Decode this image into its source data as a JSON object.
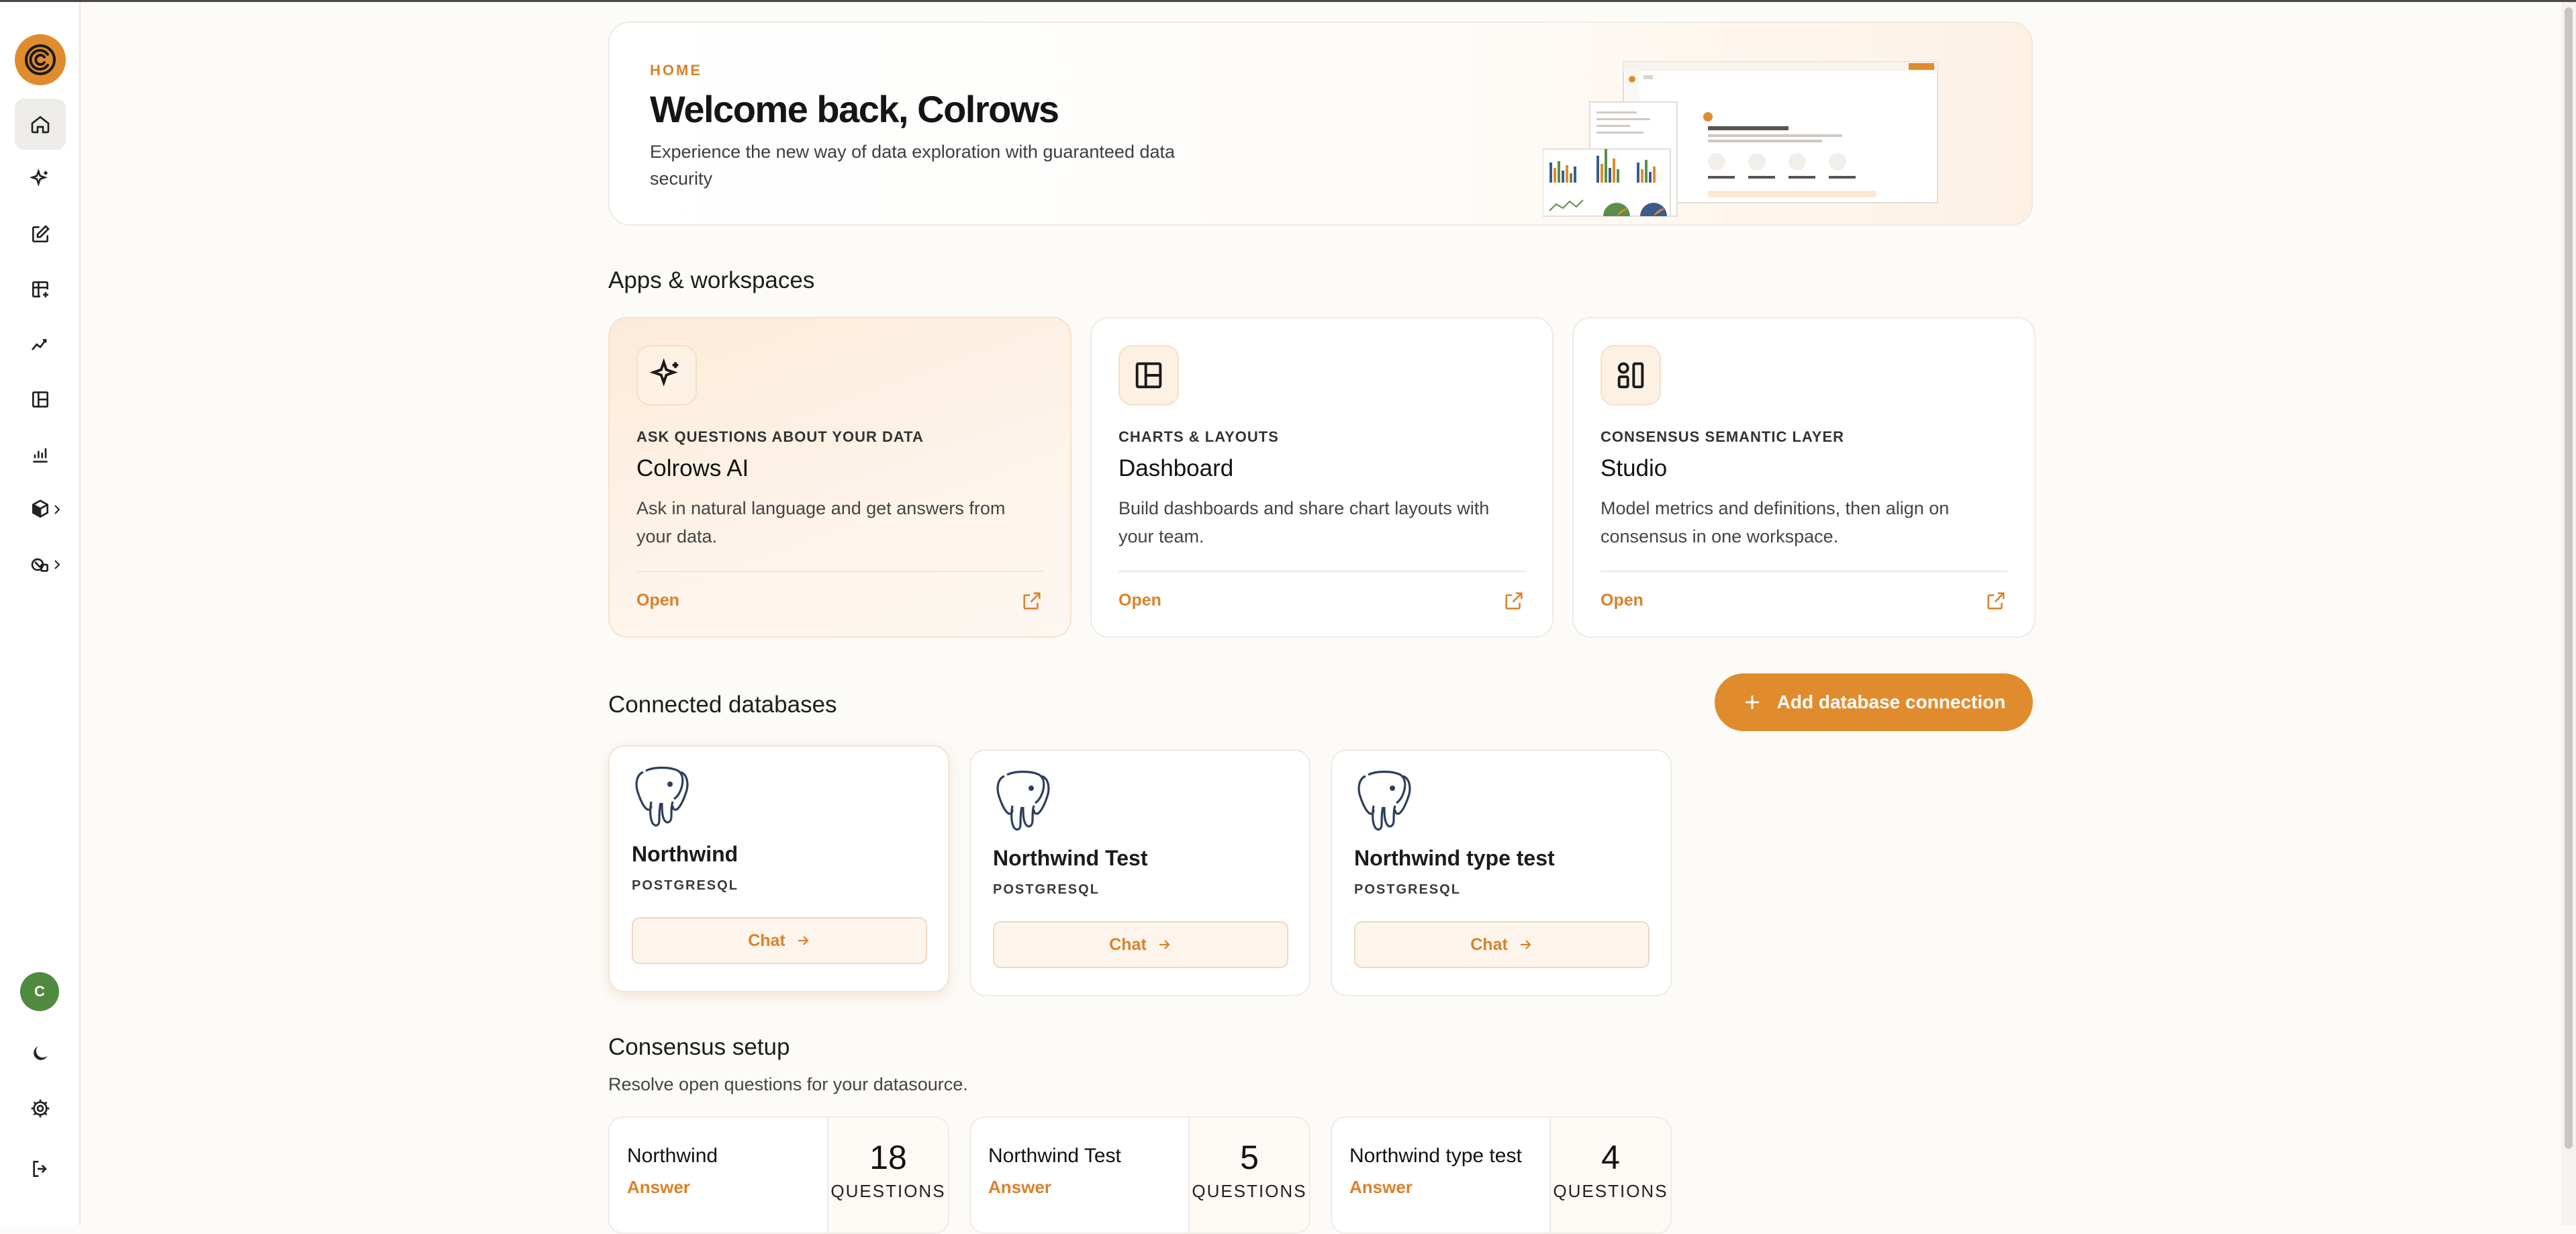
{
  "colors": {
    "accent": "#e08c2e",
    "accent_text": "#d9822b",
    "avatar_bg": "#4f8a3f"
  },
  "sidebar": {
    "logo_icon": "colrows-logo-icon",
    "items": [
      {
        "icon": "home-icon"
      },
      {
        "icon": "sparkle-icon"
      },
      {
        "icon": "edit-icon"
      },
      {
        "icon": "table-add-icon"
      },
      {
        "icon": "trend-line-icon"
      },
      {
        "icon": "layout-icon"
      },
      {
        "icon": "bar-chart-icon"
      },
      {
        "icon": "cube-icon"
      },
      {
        "icon": "data-group-icon"
      }
    ],
    "avatar_initial": "C",
    "bottom": [
      {
        "icon": "moon-icon"
      },
      {
        "icon": "gear-icon"
      },
      {
        "icon": "logout-icon"
      }
    ]
  },
  "hero": {
    "kicker": "HOME",
    "title": "Welcome back, Colrows",
    "subtitle": "Experience the new way of data exploration with guaranteed data security"
  },
  "apps": {
    "title": "Apps & workspaces",
    "cards": [
      {
        "icon": "sparkle-icon",
        "kicker": "ASK QUESTIONS ABOUT YOUR DATA",
        "name": "Colrows AI",
        "desc": "Ask in natural language and get answers from your data.",
        "open": "Open"
      },
      {
        "icon": "layout-icon",
        "kicker": "CHARTS & LAYOUTS",
        "name": "Dashboard",
        "desc": "Build dashboards and share chart layouts with your team.",
        "open": "Open"
      },
      {
        "icon": "studio-icon",
        "kicker": "CONSENSUS SEMANTIC LAYER",
        "name": "Studio",
        "desc": "Model metrics and definitions, then align on consensus in one workspace.",
        "open": "Open"
      }
    ]
  },
  "databases": {
    "title": "Connected databases",
    "add_label": "Add database connection",
    "items": [
      {
        "name": "Northwind",
        "type": "POSTGRESQL",
        "chat": "Chat"
      },
      {
        "name": "Northwind Test",
        "type": "POSTGRESQL",
        "chat": "Chat"
      },
      {
        "name": "Northwind type test",
        "type": "POSTGRESQL",
        "chat": "Chat"
      }
    ]
  },
  "consensus": {
    "title": "Consensus setup",
    "subtitle": "Resolve open questions for your datasource.",
    "items": [
      {
        "name": "Northwind",
        "action": "Answer",
        "count": "18",
        "label": "QUESTIONS"
      },
      {
        "name": "Northwind Test",
        "action": "Answer",
        "count": "5",
        "label": "QUESTIONS"
      },
      {
        "name": "Northwind type test",
        "action": "Answer",
        "count": "4",
        "label": "QUESTIONS"
      }
    ]
  }
}
